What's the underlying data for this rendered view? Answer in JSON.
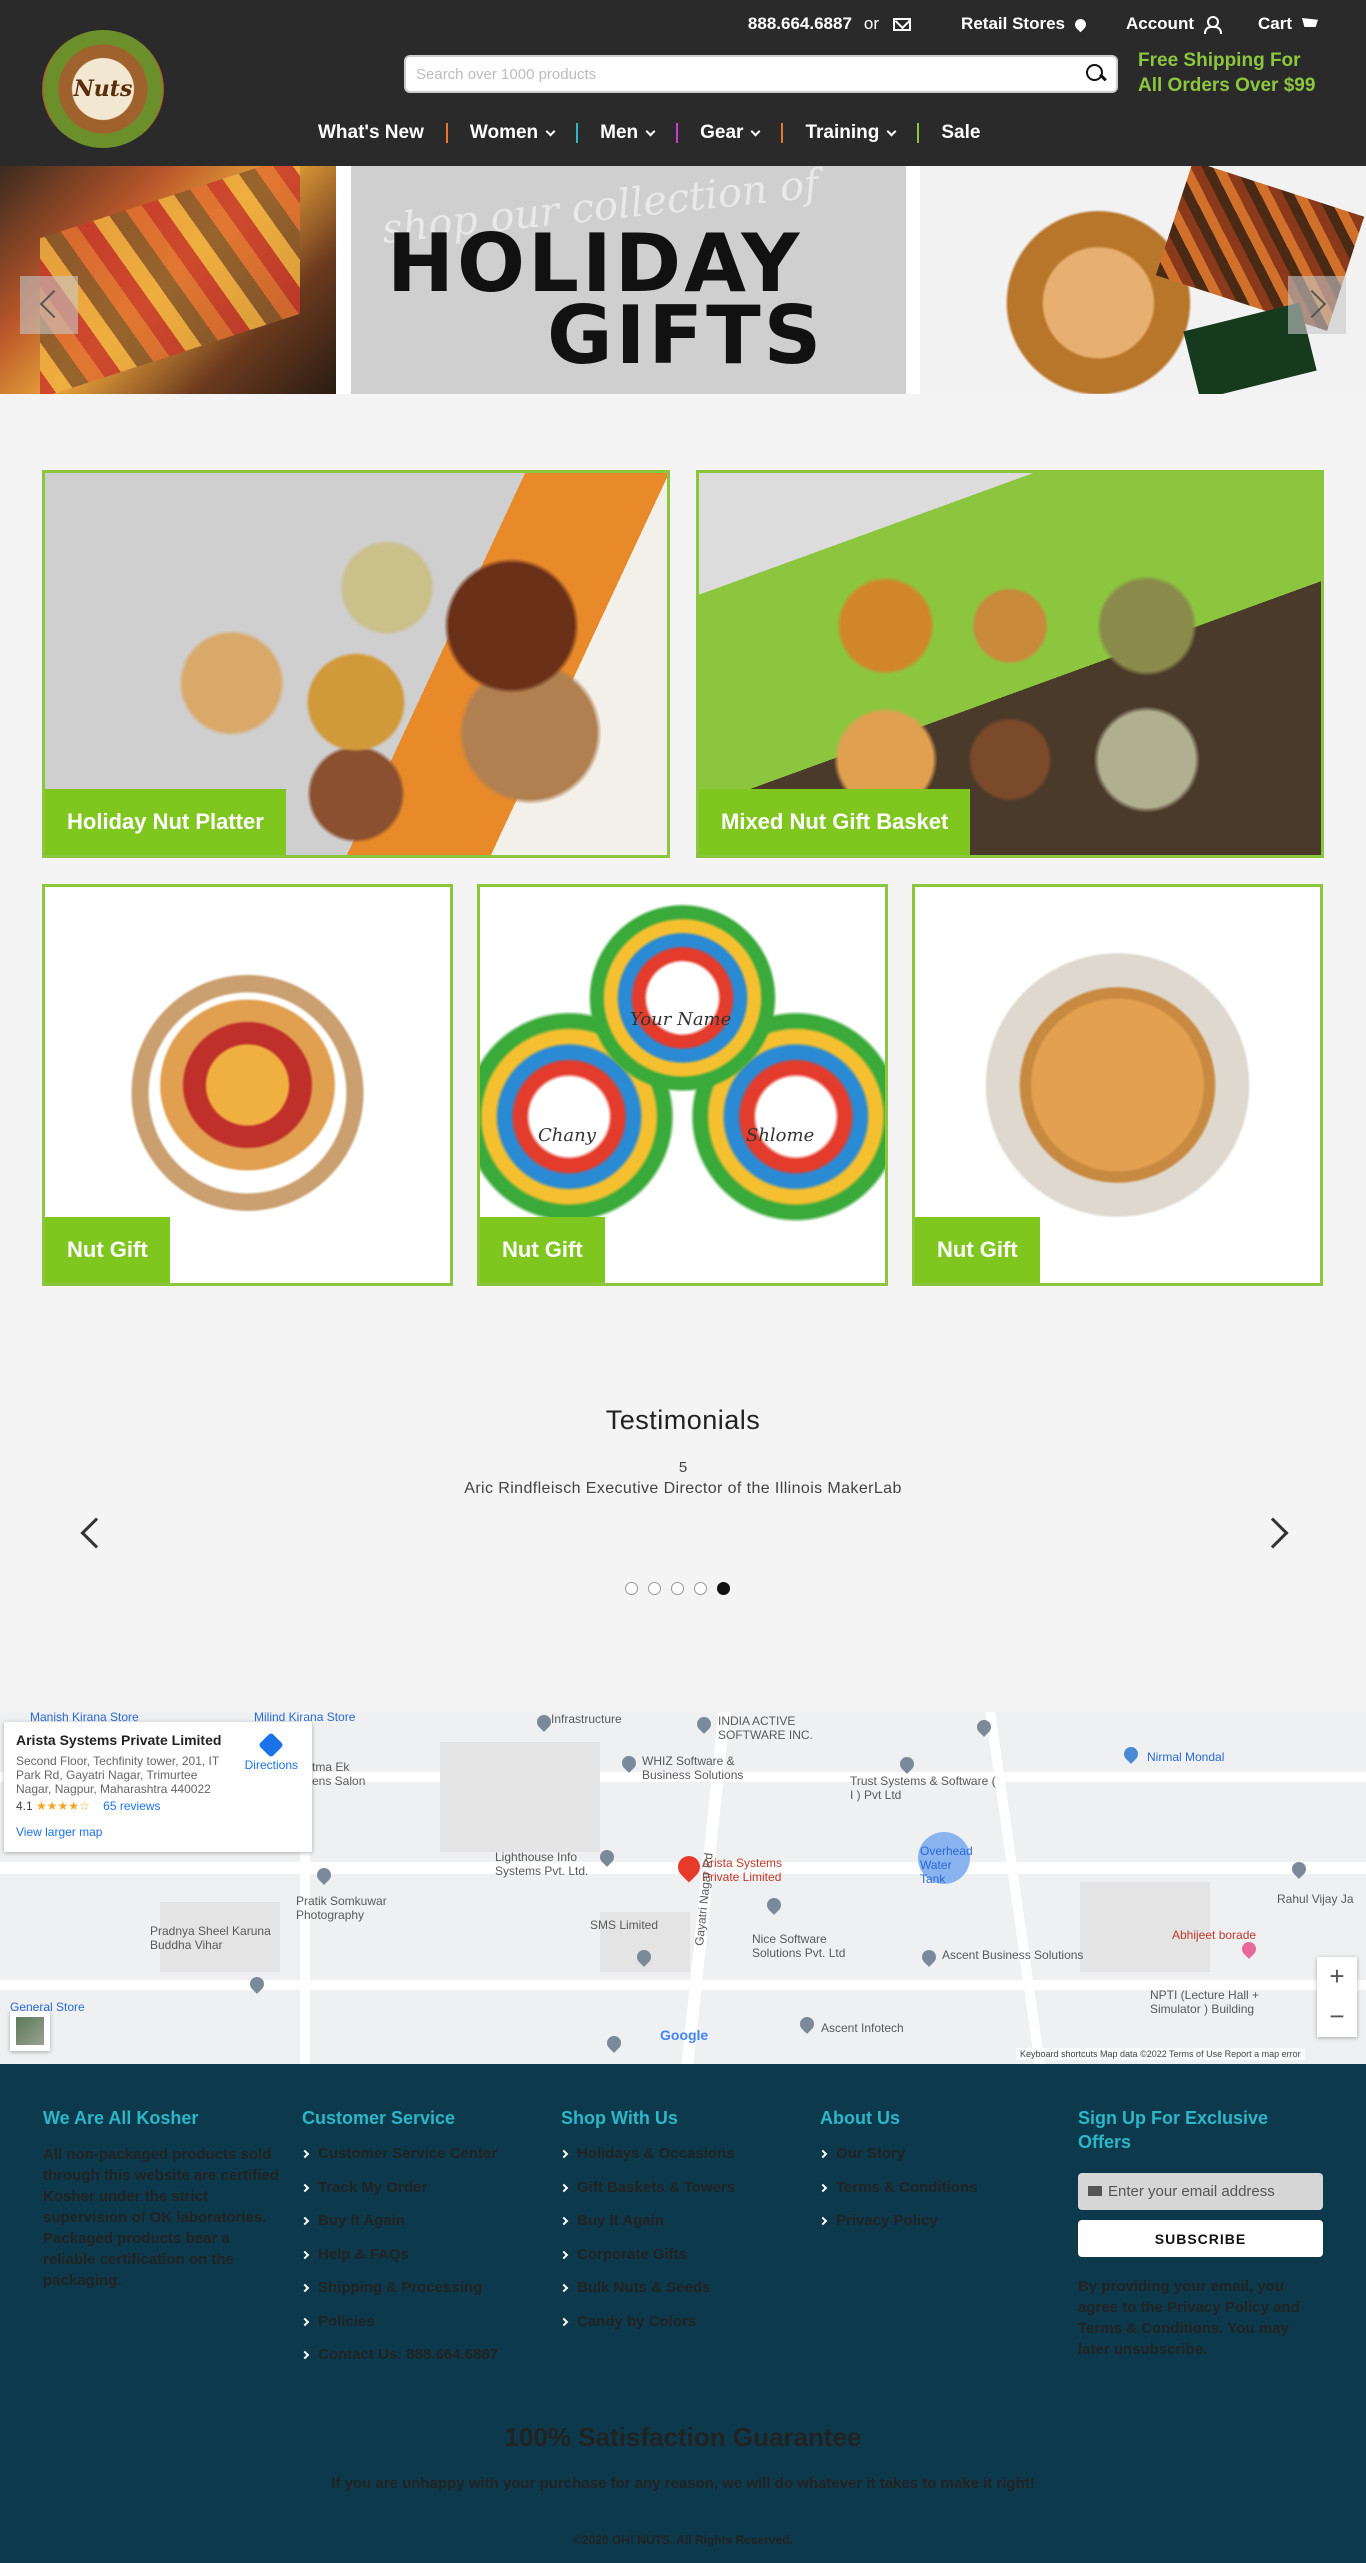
{
  "header": {
    "logo_text": "Nuts",
    "phone": "888.664.6887",
    "or_text": "or",
    "retail_stores": "Retail Stores",
    "account": "Account",
    "cart": "Cart",
    "search_placeholder": "Search over 1000 products",
    "shipping_line1": "Free Shipping For",
    "shipping_line2": "All Orders Over $99",
    "nav": [
      {
        "label": "What's New",
        "has_dropdown": false
      },
      {
        "label": "Women",
        "has_dropdown": true
      },
      {
        "label": "Men",
        "has_dropdown": true
      },
      {
        "label": "Gear",
        "has_dropdown": true
      },
      {
        "label": "Training",
        "has_dropdown": true
      },
      {
        "label": "Sale",
        "has_dropdown": false
      }
    ],
    "nav_separator_colors": [
      "#e8772a",
      "#2cb6c8",
      "#c243c9",
      "#e8772a",
      "#8cc63f"
    ]
  },
  "hero": {
    "script_text": "shop our collection of",
    "title_line1": "HOLIDAY",
    "title_line2": "GIFTS"
  },
  "products": [
    {
      "label": "Holiday Nut Platter"
    },
    {
      "label": "Mixed Nut Gift Basket"
    },
    {
      "label": "Nut Gift"
    },
    {
      "label": "Nut Gift"
    },
    {
      "label": "Nut Gift"
    }
  ],
  "lollipop_names": [
    "Your Name",
    "Chany",
    "Shlome"
  ],
  "testimonials": {
    "title": "Testimonials",
    "rating": "5",
    "quote": "Aric Rindfleisch Executive Director of the Illinois MakerLab",
    "dot_count": 5,
    "active_dot": 4
  },
  "map": {
    "card_title": "Arista Systems Private Limited",
    "card_address": "Second Floor, Techfinity tower, 201, IT Park Rd, Gayatri Nagar, Trimurtee Nagar, Nagpur, Maharashtra 440022",
    "rating": "4.1",
    "stars": "★★★★☆",
    "reviews": "65 reviews",
    "directions": "Directions",
    "view_larger": "View larger map",
    "pin_label": "Arista Systems Private Limited",
    "labels": {
      "infrastructure": "Infrastructure",
      "india_active": "INDIA ACTIVE SOFTWARE INC.",
      "whiz": "WHIZ Software & Business Solutions",
      "trust": "Trust Systems & Software ( I ) Pvt Ltd",
      "nirmal": "Nirmal Mondal",
      "lighthouse": "Lighthouse Info Systems Pvt. Ltd.",
      "overhead": "Overhead Water Tank",
      "pratik": "Pratik Somkuwar Photography",
      "pradnya": "Pradnya Sheel Karuna Buddha Vihar",
      "sms": "SMS Limited",
      "nice": "Nice Software Solutions Pvt. Ltd",
      "ascent_business": "Ascent Business Solutions",
      "abhijeet": "Abhijeet borade",
      "nptl": "NPTI (Lecture Hall + Simulator ) Building",
      "rahul": "Rahul Vijay Ja",
      "gayatri_road": "Gayatri Nagar Rd",
      "ascent_infotech": "Ascent Infotech",
      "general_store": "General Store",
      "manish": "Manish Kirana Store",
      "milind": "Milind Kirana Store",
      "salon": "tma Ek ens Salon"
    },
    "google": "Google",
    "footer_text": "Keyboard shortcuts   Map data ©2022   Terms of Use   Report a map error",
    "zoom_in": "+",
    "zoom_out": "−"
  },
  "footer": {
    "kosher_title": "We Are All Kosher",
    "kosher_text": "All non-packaged products sold through this website are certified Kosher under the strict supervision of OK laboratories. Packaged products bear a reliable certification on the packaging.",
    "customer_service_title": "Customer Service",
    "customer_service_links": [
      "Customer Service Center",
      "Track My Order",
      "Buy It Again",
      "Help & FAQs",
      "Shipping & Processing",
      "Policies",
      "Contact Us: 888.664.6887"
    ],
    "shop_title": "Shop With Us",
    "shop_links": [
      "Holidays & Occasions",
      "Gift Baskets & Towers",
      "Buy It Again",
      "Corporate Gifts",
      "Bulk Nuts & Seeds",
      "Candy by Colors"
    ],
    "about_title": "About Us",
    "about_links": [
      "Our Story",
      "Terms & Conditions",
      "Privacy Policy"
    ],
    "signup_title": "Sign Up For Exclusive Offers",
    "email_placeholder": "Enter your email address",
    "subscribe": "SUBSCRIBE",
    "disclaimer": "By providing your email, you agree to the Privacy Policy and Terms & Conditions. You may later unsubscribe.",
    "guarantee_title": "100% Satisfaction Guarantee",
    "guarantee_text": "If you are unhappy with your purchase for any reason, we will do whatever it takes to make it right!",
    "copyright": "©2020 OH! NUTS. All Rights Reserved."
  }
}
